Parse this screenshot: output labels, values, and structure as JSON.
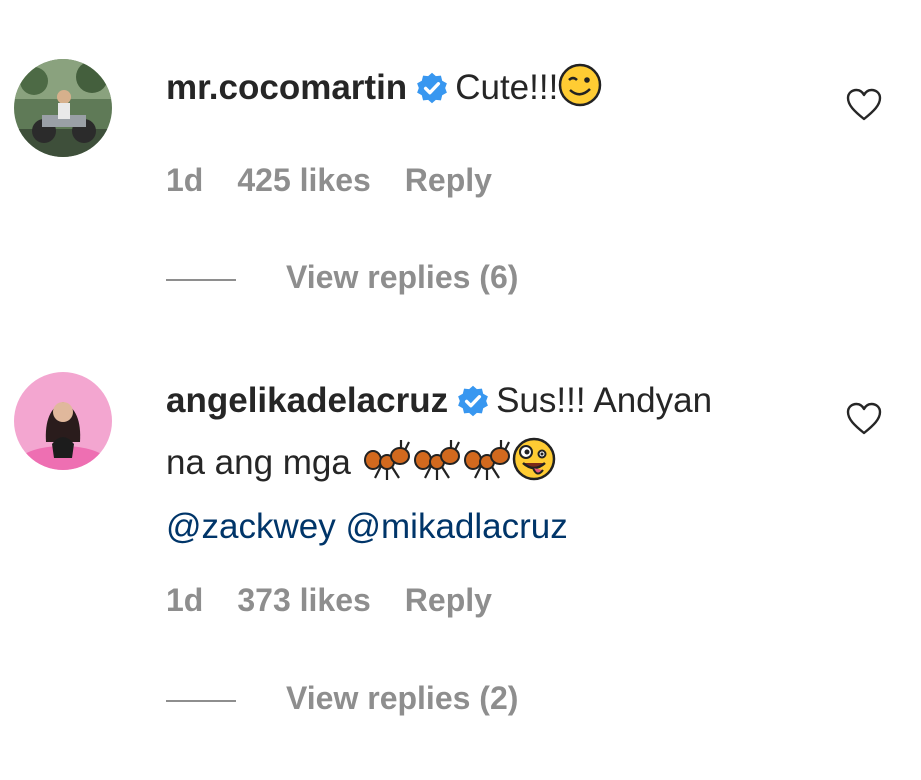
{
  "comments": [
    {
      "username": "mr.cocomartin",
      "text": "Cute!!!",
      "emoji": "winking-face",
      "mentions": "",
      "time": "1d",
      "likes": "425 likes",
      "reply_label": "Reply",
      "view_replies": "View replies (6)"
    },
    {
      "username": "angelikadelacruz",
      "text_line1": "Sus!!! Andyan",
      "text_line2": "na ang mga",
      "emojis": [
        "ant-icon",
        "ant-icon",
        "ant-icon",
        "zany-face"
      ],
      "mention1": "@zackwey",
      "mention2": "@mikadlacruz",
      "time": "1d",
      "likes": "373 likes",
      "reply_label": "Reply",
      "view_replies": "View replies (2)"
    }
  ],
  "colors": {
    "text": "#262626",
    "muted": "#8e8e8e",
    "mention": "#003569",
    "verified": "#3897f0"
  }
}
